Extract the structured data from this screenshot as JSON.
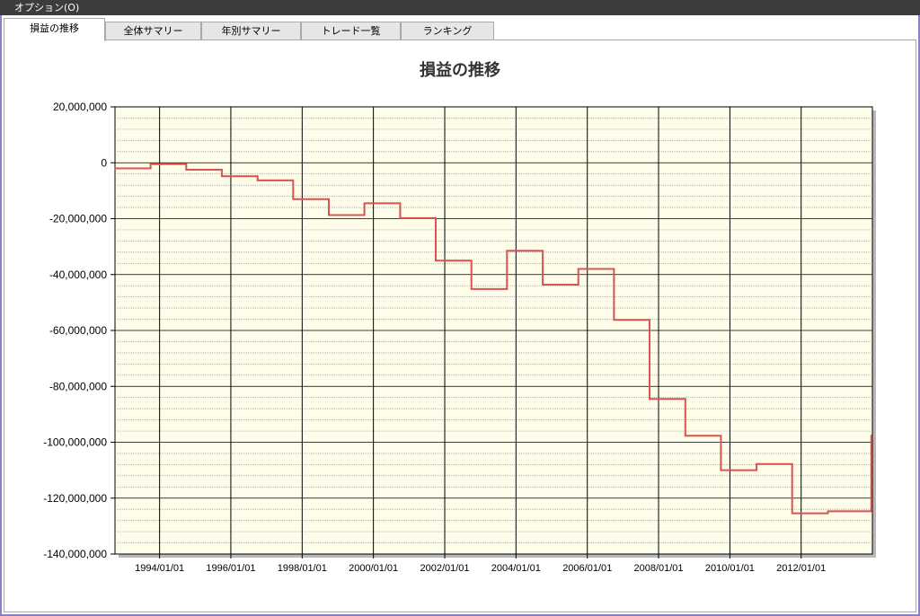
{
  "menubar": {
    "label": "オプション(O)"
  },
  "tabs": [
    {
      "label": "損益の推移",
      "active": true
    },
    {
      "label": "全体サマリー",
      "active": false
    },
    {
      "label": "年別サマリー",
      "active": false
    },
    {
      "label": "トレード一覧",
      "active": false
    },
    {
      "label": "ランキング",
      "active": false
    }
  ],
  "colors": {
    "plot_bg": "#fdfdea",
    "series": "#d9534f",
    "accent": "#8a82c8"
  },
  "chart_data": {
    "type": "line",
    "title": "損益の推移",
    "xlabel": "",
    "ylabel": "",
    "ylim": [
      -140000000,
      20000000
    ],
    "xlim": [
      "1992/10/01",
      "2013/12/31"
    ],
    "grid": true,
    "legend": "none",
    "y_ticks": [
      "20,000,000",
      "0",
      "-20,000,000",
      "-40,000,000",
      "-60,000,000",
      "-80,000,000",
      "-100,000,000",
      "-120,000,000",
      "-140,000,000"
    ],
    "x_ticks": [
      "1994/01/01",
      "1996/01/01",
      "1998/01/01",
      "2000/01/01",
      "2002/01/01",
      "2004/01/01",
      "2006/01/01",
      "2008/01/01",
      "2010/01/01",
      "2012/01/01"
    ],
    "series": [
      {
        "step": true,
        "points": [
          [
            "1992/10/01",
            -2000000
          ],
          [
            "1993/10/01",
            -500000
          ],
          [
            "1994/10/01",
            -2500000
          ],
          [
            "1995/10/01",
            -4800000
          ],
          [
            "1996/10/01",
            -6300000
          ],
          [
            "1997/10/01",
            -13000000
          ],
          [
            "1998/10/01",
            -18700000
          ],
          [
            "1999/10/01",
            -14500000
          ],
          [
            "2000/10/01",
            -19800000
          ],
          [
            "2001/10/01",
            -35000000
          ],
          [
            "2002/10/01",
            -45200000
          ],
          [
            "2003/10/01",
            -31500000
          ],
          [
            "2004/10/01",
            -43600000
          ],
          [
            "2005/10/01",
            -38000000
          ],
          [
            "2006/10/01",
            -56200000
          ],
          [
            "2007/10/01",
            -84500000
          ],
          [
            "2008/10/01",
            -97700000
          ],
          [
            "2009/10/01",
            -110000000
          ],
          [
            "2010/10/01",
            -107800000
          ],
          [
            "2011/10/01",
            -125400000
          ],
          [
            "2012/10/01",
            -124700000
          ],
          [
            "2013/12/20",
            -97500000
          ]
        ]
      }
    ]
  }
}
